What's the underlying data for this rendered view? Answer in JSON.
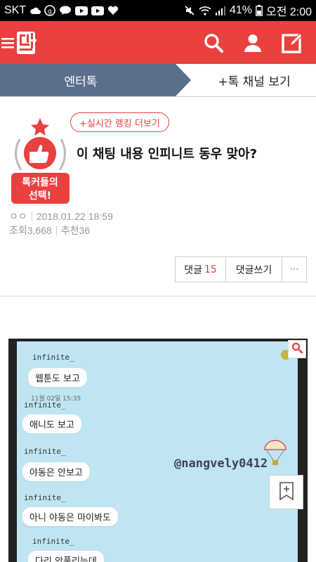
{
  "status_bar": {
    "carrier": "SKT",
    "battery": "41%",
    "time": "오전 2:00"
  },
  "app": {
    "logo_text": "판",
    "accent_color": "#e8413f",
    "tab_color": "#5a6f8c"
  },
  "tabs": {
    "active": "엔터톡",
    "other": "+톡 채널 보기"
  },
  "post": {
    "badge_text_line1": "톡커들의",
    "badge_text_line2": "선택!",
    "rank_button": "+실시간 랭킹 더보기",
    "title": "이 채팅 내용 인피니트 동우 맞아?",
    "author": "ㅇㅇ",
    "date": "2018.01.22 18:59",
    "views": "조회3,668",
    "recommend": "추천36"
  },
  "actions": {
    "comments_label": "댓글",
    "comments_count": "15",
    "write_comment": "댓글쓰기",
    "more": "···"
  },
  "chat_image": {
    "watermark": "@nangvely0412",
    "messages": [
      {
        "name": "infinite_",
        "text": "웹툰도 보고"
      },
      {
        "name": "infinite_",
        "text": "애니도 보고",
        "time": "11월 02일 15:35"
      },
      {
        "name": "infinite_",
        "text": "야동은 안보고"
      },
      {
        "name": "infinite_",
        "text": "아니 야동은 마이봐도"
      },
      {
        "name": "infinite_",
        "text": "다리 안풀리는데"
      }
    ]
  }
}
